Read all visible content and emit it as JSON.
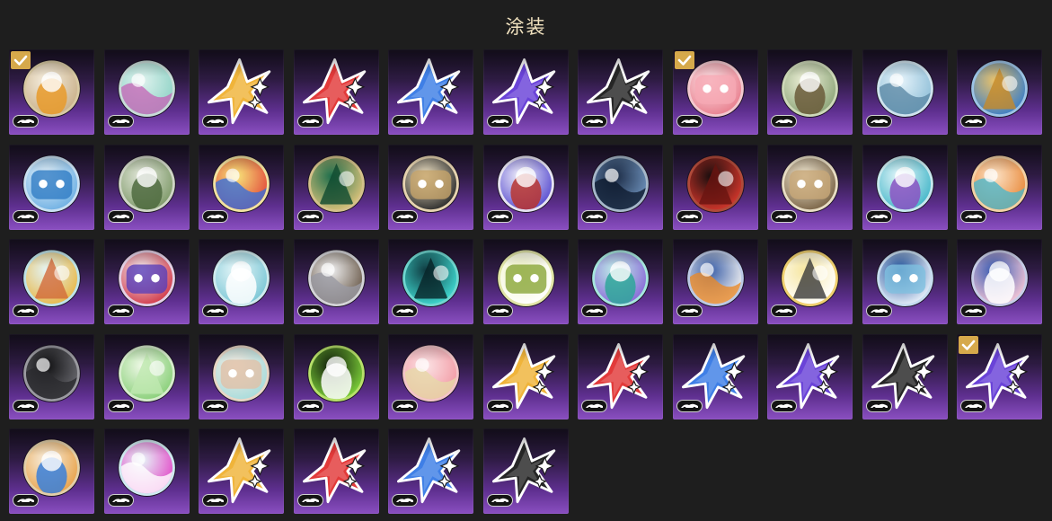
{
  "page": {
    "title": "涂装"
  },
  "colors": {
    "check": "#d6a94b",
    "title": "#f2e3c0",
    "background": "#1e1e1e"
  },
  "columns": 11,
  "tiles": [
    {
      "name": "skin-chibi-white",
      "kind": "avatar",
      "ring": "#d8c9a3",
      "c1": "#f6efe0",
      "c2": "#c9b08a",
      "c3": "#e79a2a",
      "checked": true
    },
    {
      "name": "skin-teal-swirl",
      "kind": "avatar",
      "ring": "#c8dcd8",
      "c1": "#dff2ee",
      "c2": "#8fd3c6",
      "c3": "#c46ab8",
      "checked": false
    },
    {
      "name": "star-gold",
      "kind": "star",
      "color": "#f0b43a",
      "checked": false
    },
    {
      "name": "star-red",
      "kind": "star",
      "color": "#e23a3a",
      "checked": false
    },
    {
      "name": "star-blue",
      "kind": "star",
      "color": "#3f7fe6",
      "checked": false
    },
    {
      "name": "star-purple",
      "kind": "star",
      "color": "#6a43d8",
      "checked": false
    },
    {
      "name": "star-black",
      "kind": "star",
      "color": "#262626",
      "checked": false
    },
    {
      "name": "skin-pink-girl",
      "kind": "avatar",
      "ring": "#f3c8cf",
      "c1": "#fbe1e4",
      "c2": "#e9808f",
      "c3": "#f6a9b4",
      "checked": true
    },
    {
      "name": "skin-robot-green",
      "kind": "avatar",
      "ring": "#cdd8b8",
      "c1": "#eef0d8",
      "c2": "#8ea67a",
      "c3": "#6a5a3a",
      "checked": false
    },
    {
      "name": "skin-light-blue",
      "kind": "avatar",
      "ring": "#cfe3ee",
      "c1": "#e6f3fa",
      "c2": "#8fbfd8",
      "c3": "#5d8aa6",
      "checked": false
    },
    {
      "name": "skin-gold-wave",
      "kind": "avatar",
      "ring": "#9cc3e6",
      "c1": "#e8c16a",
      "c2": "#3e7fc6",
      "c3": "#c48a2a",
      "checked": false
    },
    {
      "name": "skin-blue-waves",
      "kind": "avatar",
      "ring": "#c9e0f2",
      "c1": "#e8f4fb",
      "c2": "#6fb0e3",
      "c3": "#2f7cc4",
      "checked": false
    },
    {
      "name": "skin-green-trio",
      "kind": "avatar",
      "ring": "#cfd5c6",
      "c1": "#e4e8dc",
      "c2": "#7f9a6a",
      "c3": "#4d6a3e",
      "checked": false
    },
    {
      "name": "skin-yellow-comic",
      "kind": "avatar",
      "ring": "#f2e2a0",
      "c1": "#f7e57a",
      "c2": "#e24a3a",
      "c3": "#3a6fd8",
      "checked": false
    },
    {
      "name": "skin-green-emblem",
      "kind": "avatar",
      "ring": "#d3c08a",
      "c1": "#1f6e4c",
      "c2": "#d9c27a",
      "c3": "#0f4a30",
      "checked": false
    },
    {
      "name": "skin-beige-logo",
      "kind": "avatar",
      "ring": "#e6d3b0",
      "c1": "#f3e6c8",
      "c2": "#2b2b2b",
      "c3": "#c6a46a",
      "checked": false
    },
    {
      "name": "skin-white-crest",
      "kind": "avatar",
      "ring": "#e6e3f2",
      "c1": "#f4f3fb",
      "c2": "#5a4fd0",
      "c3": "#b7342f",
      "checked": false
    },
    {
      "name": "skin-dark-tree",
      "kind": "avatar",
      "ring": "#a6b7c9",
      "c1": "#1b2a44",
      "c2": "#6f93bd",
      "c3": "#0e1a2e",
      "checked": false
    },
    {
      "name": "skin-red-dark",
      "kind": "avatar",
      "ring": "#b04a3a",
      "c1": "#1a0e0e",
      "c2": "#d2362b",
      "c3": "#6a1410",
      "checked": false
    },
    {
      "name": "skin-cream-ring",
      "kind": "avatar",
      "ring": "#e8ddc4",
      "c1": "#f3ead4",
      "c2": "#7a6446",
      "c3": "#c8a878",
      "checked": false
    },
    {
      "name": "skin-cyan-creature",
      "kind": "avatar",
      "ring": "#c7e8ee",
      "c1": "#e8f7fb",
      "c2": "#45b7c9",
      "c3": "#8a52c2",
      "checked": false
    },
    {
      "name": "skin-orange-mech",
      "kind": "avatar",
      "ring": "#f3d0a4",
      "c1": "#fbe2c6",
      "c2": "#e9893a",
      "c3": "#4fb6c9",
      "checked": false
    },
    {
      "name": "skin-blonde-chibi",
      "kind": "avatar",
      "ring": "#bfe3e8",
      "c1": "#e3f4f6",
      "c2": "#e8b84a",
      "c3": "#d26a3a",
      "checked": false
    },
    {
      "name": "skin-stripe-red",
      "kind": "avatar",
      "ring": "#e3d0e6",
      "c1": "#f2f0f4",
      "c2": "#d23a4a",
      "c3": "#5a3fb8",
      "checked": false
    },
    {
      "name": "skin-ghost-teal",
      "kind": "avatar",
      "ring": "#cfeaee",
      "c1": "#e6f6f8",
      "c2": "#7cc7d6",
      "c3": "#ffffff",
      "checked": false
    },
    {
      "name": "skin-white-orb",
      "kind": "avatar",
      "ring": "#d4d4d8",
      "c1": "#eeeeef",
      "c2": "#6a5a4a",
      "c3": "#9a9aa2",
      "checked": false
    },
    {
      "name": "skin-teal-hex",
      "kind": "avatar",
      "ring": "#6fd6d0",
      "c1": "#0f3a40",
      "c2": "#3fd8d0",
      "c3": "#082428",
      "checked": false
    },
    {
      "name": "skin-bunny-yellow",
      "kind": "avatar",
      "ring": "#e2e6a8",
      "c1": "#f0f3c8",
      "c2": "#ffffff",
      "c3": "#8aa63a",
      "checked": false
    },
    {
      "name": "skin-space-teal",
      "kind": "avatar",
      "ring": "#a6e6de",
      "c1": "#bff0e8",
      "c2": "#8a6ad8",
      "c3": "#2fa69a",
      "checked": false
    },
    {
      "name": "skin-penguin",
      "kind": "avatar",
      "ring": "#bcc9e6",
      "c1": "#3b5fa8",
      "c2": "#f2f2f2",
      "c3": "#e88a2a",
      "checked": false
    },
    {
      "name": "skin-cow-gold",
      "kind": "avatar",
      "ring": "#f0d070",
      "c1": "#f6e6a0",
      "c2": "#ffffff",
      "c3": "#3a3a3a",
      "checked": false
    },
    {
      "name": "skin-blue-scene",
      "kind": "avatar",
      "ring": "#c6dcf0",
      "c1": "#1d4f9a",
      "c2": "#e8f0fa",
      "c3": "#7fc0e0",
      "checked": false
    },
    {
      "name": "skin-pink-chibi",
      "kind": "avatar",
      "ring": "#c8cde8",
      "c1": "#3458b0",
      "c2": "#f4c6d6",
      "c3": "#ffffff",
      "checked": false
    },
    {
      "name": "skin-dark-knight",
      "kind": "avatar",
      "ring": "#9a9aa0",
      "c1": "#101012",
      "c2": "#6a6a70",
      "c3": "#2a2a2e",
      "checked": false
    },
    {
      "name": "skin-mint-ghost",
      "kind": "avatar",
      "ring": "#d6eccc",
      "c1": "#eef8e6",
      "c2": "#8ad07a",
      "c3": "#bfe8b0",
      "checked": false
    },
    {
      "name": "skin-aqua-beast",
      "kind": "avatar",
      "ring": "#e8d6c6",
      "c1": "#f6ece2",
      "c2": "#a8dcdc",
      "c3": "#e0c0a8",
      "checked": false
    },
    {
      "name": "skin-green-glitch",
      "kind": "avatar",
      "ring": "#b7e06a",
      "c1": "#0e1a0a",
      "c2": "#7ed23a",
      "c3": "#ffffff",
      "checked": false
    },
    {
      "name": "skin-pink-beast",
      "kind": "avatar",
      "ring": "#f3c4c8",
      "c1": "#fbe2e4",
      "c2": "#f29aa4",
      "c3": "#e6d8a8",
      "checked": false
    },
    {
      "name": "star-gold",
      "kind": "star",
      "color": "#f0b43a",
      "checked": false
    },
    {
      "name": "star-red",
      "kind": "star",
      "color": "#e23a3a",
      "checked": false
    },
    {
      "name": "star-blue",
      "kind": "star",
      "color": "#3f7fe6",
      "checked": false
    },
    {
      "name": "star-purple",
      "kind": "star",
      "color": "#6a43d8",
      "checked": false
    },
    {
      "name": "star-black",
      "kind": "star",
      "color": "#262626",
      "checked": false
    },
    {
      "name": "star-purple",
      "kind": "star",
      "color": "#6a43d8",
      "checked": true
    },
    {
      "name": "skin-chibi-white",
      "kind": "avatar",
      "ring": "#e3cfa8",
      "c1": "#f7efe0",
      "c2": "#e8a24a",
      "c3": "#3a7fd8",
      "checked": false
    },
    {
      "name": "skin-pink-cat",
      "kind": "avatar",
      "ring": "#cfeaf0",
      "c1": "#e6f6f8",
      "c2": "#e24ac8",
      "c3": "#ffffff",
      "checked": false
    },
    {
      "name": "star-gold",
      "kind": "star",
      "color": "#f0b43a",
      "checked": false
    },
    {
      "name": "star-red",
      "kind": "star",
      "color": "#e23a3a",
      "checked": false
    },
    {
      "name": "star-blue",
      "kind": "star",
      "color": "#3f7fe6",
      "checked": false
    },
    {
      "name": "star-black",
      "kind": "star",
      "color": "#262626",
      "checked": false
    }
  ]
}
